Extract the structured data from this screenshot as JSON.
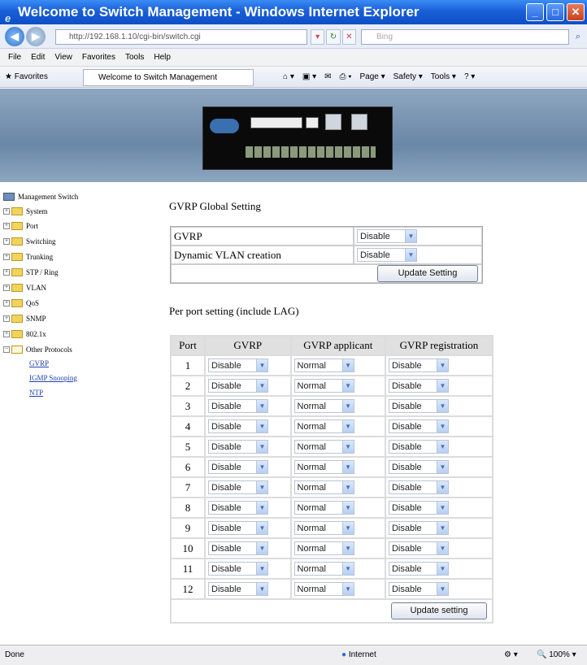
{
  "window": {
    "title": "Welcome to Switch Management - Windows Internet Explorer"
  },
  "addressbar": {
    "url": "http://192.168.1.10/cgi-bin/switch.cgi",
    "search_placeholder": "Bing"
  },
  "menu": [
    "File",
    "Edit",
    "View",
    "Favorites",
    "Tools",
    "Help"
  ],
  "favorites": {
    "label": "Favorites",
    "tab_title": "Welcome to Switch Management"
  },
  "commandbar": [
    "Page ▾",
    "Safety ▾",
    "Tools ▾"
  ],
  "sidebar": {
    "root": "Management Switch",
    "folders": [
      "System",
      "Port",
      "Switching",
      "Trunking",
      "STP / Ring",
      "VLAN",
      "QoS",
      "SNMP",
      "802.1x",
      "Other Protocols"
    ],
    "links": [
      "GVRP",
      "IGMP Snooping",
      "NTP"
    ]
  },
  "main": {
    "global_title": "GVRP Global Setting",
    "global_rows": [
      {
        "label": "GVRP",
        "value": "Disable"
      },
      {
        "label": "Dynamic VLAN creation",
        "value": "Disable"
      }
    ],
    "update_global_label": "Update Setting",
    "perport_title": "Per port setting (include LAG)",
    "columns": [
      "Port",
      "GVRP",
      "GVRP applicant",
      "GVRP registration"
    ],
    "ports": [
      {
        "port": "1",
        "gvrp": "Disable",
        "applicant": "Normal",
        "registration": "Disable"
      },
      {
        "port": "2",
        "gvrp": "Disable",
        "applicant": "Normal",
        "registration": "Disable"
      },
      {
        "port": "3",
        "gvrp": "Disable",
        "applicant": "Normal",
        "registration": "Disable"
      },
      {
        "port": "4",
        "gvrp": "Disable",
        "applicant": "Normal",
        "registration": "Disable"
      },
      {
        "port": "5",
        "gvrp": "Disable",
        "applicant": "Normal",
        "registration": "Disable"
      },
      {
        "port": "6",
        "gvrp": "Disable",
        "applicant": "Normal",
        "registration": "Disable"
      },
      {
        "port": "7",
        "gvrp": "Disable",
        "applicant": "Normal",
        "registration": "Disable"
      },
      {
        "port": "8",
        "gvrp": "Disable",
        "applicant": "Normal",
        "registration": "Disable"
      },
      {
        "port": "9",
        "gvrp": "Disable",
        "applicant": "Normal",
        "registration": "Disable"
      },
      {
        "port": "10",
        "gvrp": "Disable",
        "applicant": "Normal",
        "registration": "Disable"
      },
      {
        "port": "11",
        "gvrp": "Disable",
        "applicant": "Normal",
        "registration": "Disable"
      },
      {
        "port": "12",
        "gvrp": "Disable",
        "applicant": "Normal",
        "registration": "Disable"
      }
    ],
    "update_ports_label": "Update setting"
  },
  "statusbar": {
    "left": "Done",
    "zone": "Internet",
    "zoom": "100%"
  }
}
